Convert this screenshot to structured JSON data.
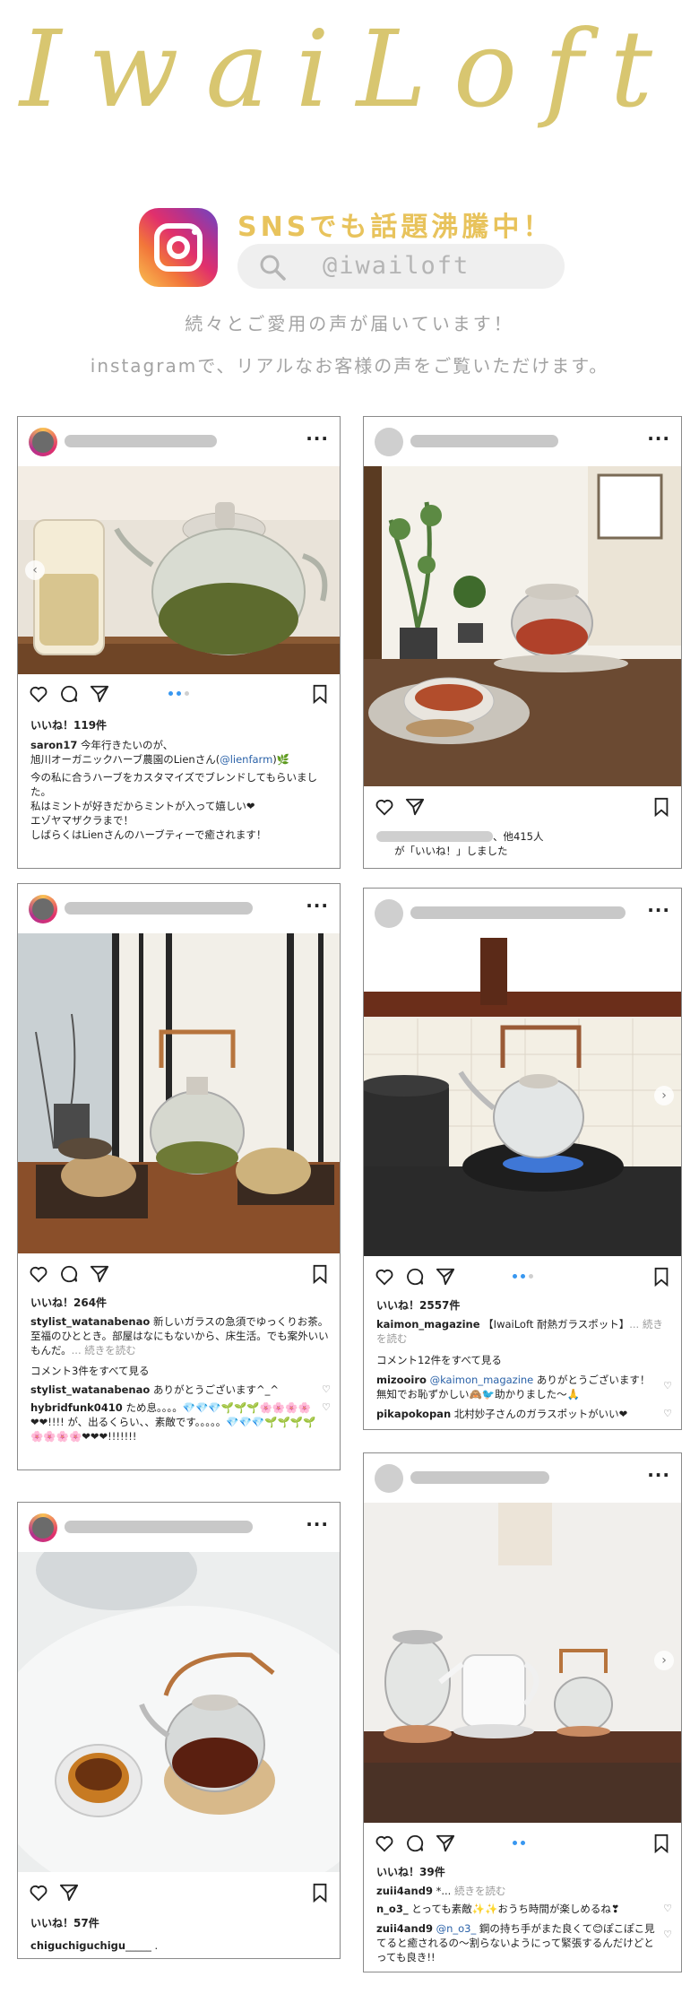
{
  "brand": {
    "logo_text": "IwaiLoft"
  },
  "sns": {
    "title": "SNSでも話題沸騰中！",
    "search_handle": "@iwailoft",
    "subtitle1": "続々とご愛用の声が届いています！",
    "subtitle2": "instagramで、リアルなお客様の声をご覧いただけます。"
  },
  "colors": {
    "gold": "#d8c670",
    "link": "#2b62a8",
    "carousel_dot": "#3897f0"
  },
  "posts": [
    {
      "likes": "いいね！119件",
      "caption": [
        {
          "user": "saron17",
          "text": " 今年行きたいのが、"
        },
        {
          "text": "旭川オーガニックハーブ農園のLienさん(",
          "link": "@lienfarm",
          "after": ")🌿"
        },
        {
          "text": "今の私に合うハーブをカスタマイズでブレンドしてもらいました。"
        },
        {
          "text": "私はミントが好きだからミントが入って嬉しい❤"
        },
        {
          "text": "エゾヤマザクラまで！"
        },
        {
          "text": "しばらくはLienさんのハーブティーで癒されます！"
        }
      ]
    },
    {
      "liked_by_suffix": "、他415人",
      "liked_line2": "が「いいね！」しました"
    },
    {
      "likes": "いいね！264件",
      "caption_user": "stylist_watanabenao",
      "caption_text": " 新しいガラスの急須でゆっくりお茶。至福のひととき。部屋はなにもないから、床生活。でも案外いいもんだ。",
      "more": "... 続きを読む",
      "view_comments": "コメント3件をすべて見る",
      "comments": [
        {
          "user": "stylist_watanabenao",
          "text": " ありがとうございます^_^"
        },
        {
          "user": "hybridfunk0410",
          "text": " ため息。。。。💎💎💎🌱🌱🌱🌸🌸🌸🌸❤❤!!!! が、出るくらい、、素敵です。。。。。💎💎💎🌱🌱🌱🌱🌸🌸🌸🌸❤❤❤!!!!!!!"
        }
      ]
    },
    {
      "likes": "いいね！2557件",
      "caption_user": "kaimon_magazine",
      "caption_text": " 【IwaiLoft 耐熱ガラスポット】",
      "more": "... 続きを読む",
      "view_comments": "コメント12件をすべて見る",
      "comments": [
        {
          "user": "mizooiro",
          "mention": "@kaimon_magazine",
          "text": " ありがとうございます！無知でお恥ずかしい🙈🐦助かりました〜🙏"
        },
        {
          "user": "pikapokopan",
          "text": " 北村妙子さんのガラスポットがいい❤"
        }
      ]
    },
    {
      "likes": "いいね！57件",
      "caption_user": "chiguchiguchigu",
      "caption_text": "_____ ."
    },
    {
      "likes": "いいね！39件",
      "caption_user": "zuii4and9",
      "caption_text": " *...",
      "more": " 続きを読む",
      "comments": [
        {
          "user": "n_o3_",
          "text": " とっても素敵✨✨おうち時間が楽しめるね❣"
        },
        {
          "user": "zuii4and9",
          "mention": "@n_o3_",
          "text": " 鋼の持ち手がまた良くて😊ぽこぽこ見てると癒されるの〜割らないようにって緊張するんだけどとっても良き!!"
        }
      ]
    }
  ]
}
